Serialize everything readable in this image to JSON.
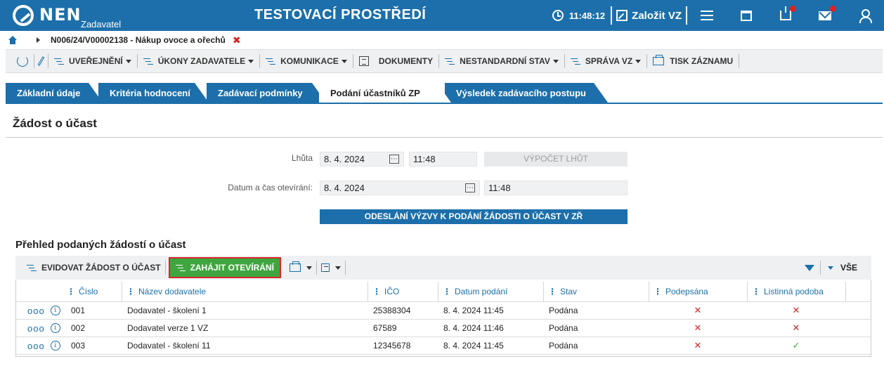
{
  "header": {
    "logo_text": "NEN",
    "logo_sub": "Zadavatel",
    "env_title": "TESTOVACÍ PROSTŘEDÍ",
    "clock": "11:48:12",
    "create_label": "Založit VZ",
    "icons": [
      "clock-icon",
      "edit-icon",
      "menu-icon",
      "calendar-icon",
      "inbox-icon",
      "mail-icon",
      "user-icon"
    ],
    "accent_color": "#1c6faa",
    "notification_color": "#e02020"
  },
  "breadcrumb": {
    "text": "N006/24/V00002138 - Nákup ovoce a ořechů",
    "close": "✖"
  },
  "toolbar": {
    "items": [
      {
        "label": "UVEŘEJNĚNÍ"
      },
      {
        "label": "ÚKONY ZADAVATELE"
      },
      {
        "label": "KOMUNIKACE"
      },
      {
        "label": "DOKUMENTY"
      },
      {
        "label": "NESTANDARDNÍ STAV"
      },
      {
        "label": "SPRÁVA VZ"
      },
      {
        "label": "TISK ZÁZNAMU"
      }
    ]
  },
  "tabs": [
    {
      "label": "Základní údaje"
    },
    {
      "label": "Kritéria hodnocení"
    },
    {
      "label": "Zadávací podmínky"
    },
    {
      "label": "Podání účastníků ZP",
      "active": true
    },
    {
      "label": "Výsledek zadávacího postupu"
    }
  ],
  "panel": {
    "title": "Žádost o účast",
    "lhuta_label": "Lhůta",
    "lhuta_date": "8. 4. 2024",
    "lhuta_time": "11:48",
    "vypocet_label": "VÝPOČET LHŮT",
    "opening_label": "Datum a čas otevírání:",
    "opening_date": "8. 4. 2024",
    "opening_time": "11:48",
    "send_button": "ODESLÁNÍ VÝZVY K PODÁNÍ ŽÁDOSTI O ÚČAST V ZŘ"
  },
  "overview": {
    "title": "Přehled podaných žádostí o účast",
    "evidovat_label": "EVIDOVAT ŽÁDOST O ÚČAST",
    "zahajit_label": "ZAHÁJIT OTEVÍRÁNÍ",
    "filter_all": "VŠE",
    "columns": [
      "Číslo",
      "Název dodavatele",
      "IČO",
      "Datum podání",
      "Stav",
      "Podepsána",
      "Listinná podoba"
    ],
    "rows": [
      {
        "cislo": "001",
        "nazev": "Dodavatel - školení 1",
        "ico": "25388304",
        "datum": "8. 4. 2024 11:45",
        "stav": "Podána",
        "podepsana": "✕",
        "listinna": "✕"
      },
      {
        "cislo": "002",
        "nazev": "Dodavatel verze 1 VZ",
        "ico": "67589",
        "datum": "8. 4. 2024 11:46",
        "stav": "Podána",
        "podepsana": "✕",
        "listinna": "✕"
      },
      {
        "cislo": "003",
        "nazev": "Dodavatel - školení 11",
        "ico": "12345678",
        "datum": "8. 4. 2024 11:45",
        "stav": "Podána",
        "podepsana": "✕",
        "listinna": "✓"
      }
    ],
    "row_menu": "ooo",
    "info_glyph": "i"
  }
}
